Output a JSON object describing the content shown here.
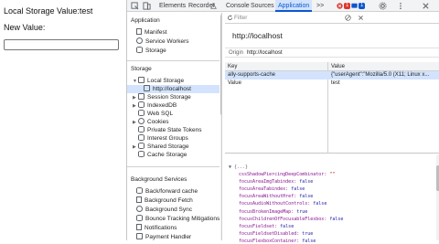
{
  "page": {
    "line1": "Local Storage Value:test",
    "line2": "New Value:",
    "input_value": ""
  },
  "devtools": {
    "tabs": [
      "Elements",
      "Recorder",
      "Console",
      "Sources",
      "Application",
      ">>"
    ],
    "active_tab": "Application",
    "error_count": "1",
    "info_count": "1",
    "sidebar": {
      "application_head": "Application",
      "app_items": [
        "Manifest",
        "Service Workers",
        "Storage"
      ],
      "storage_head": "Storage",
      "storage_items": [
        "Local Storage",
        "http://localhost",
        "Session Storage",
        "IndexedDB",
        "Web SQL",
        "Cookies",
        "Private State Tokens",
        "Interest Groups",
        "Shared Storage",
        "Cache Storage"
      ],
      "bg_head": "Background Services",
      "bg_items": [
        "Back/forward cache",
        "Background Fetch",
        "Background Sync",
        "Bounce Tracking Mitigations",
        "Notifications",
        "Payment Handler"
      ]
    },
    "filter_placeholder": "Filter",
    "origin_title": "http://localhost",
    "origin_label": "Origin",
    "origin_value": "http://localhost",
    "table": {
      "headers": [
        "Key",
        "Value"
      ],
      "rows": [
        {
          "key": "ally-supports-cache",
          "value": "{\"userAgent\":\"Mozilla/5.0 (X11; Linux x..."
        },
        {
          "key": "Value",
          "value": "test"
        }
      ]
    },
    "preview": {
      "root": "▼ {...}",
      "lines": [
        {
          "k": "cssShadowPiercingDeepCombinator",
          "v": "\"\""
        },
        {
          "k": "focusAreaImgTabindex",
          "v": "false"
        },
        {
          "k": "focusAreaTabindex",
          "v": "false"
        },
        {
          "k": "focusAreaWithoutHref",
          "v": "false"
        },
        {
          "k": "focusAudioWithoutControls",
          "v": "false"
        },
        {
          "k": "focusBrokenImageMap",
          "v": "true"
        },
        {
          "k": "focusChildrenOfFocusableFlexbox",
          "v": "false"
        },
        {
          "k": "focusFieldset",
          "v": "false"
        },
        {
          "k": "focusFieldsetDisabled",
          "v": "true"
        },
        {
          "k": "focusFlexboxContainer",
          "v": "false"
        }
      ]
    }
  }
}
